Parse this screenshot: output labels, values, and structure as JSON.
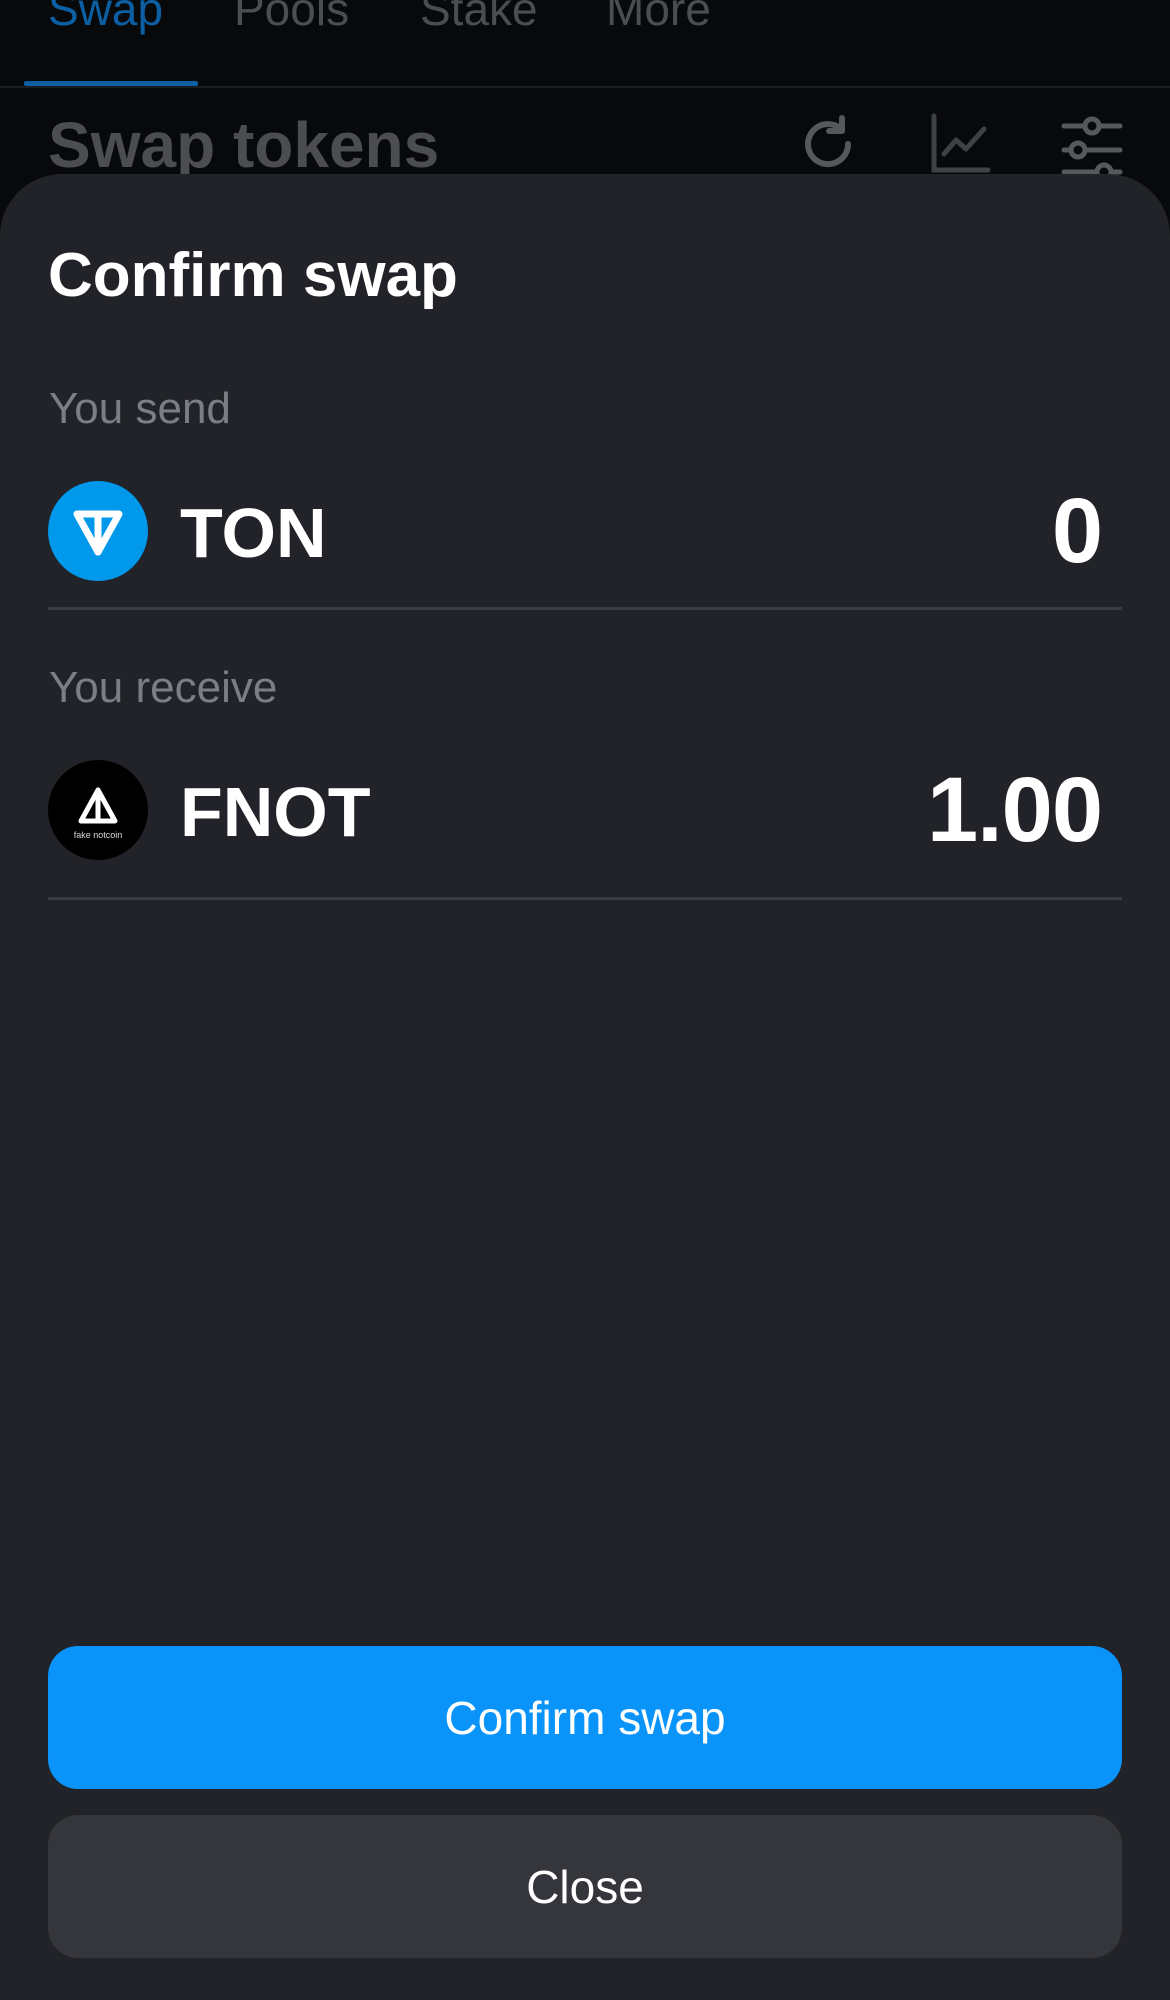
{
  "background": {
    "tabs": [
      {
        "label": "Swap",
        "active": true
      },
      {
        "label": "Pools",
        "active": false
      },
      {
        "label": "Stake",
        "active": false
      },
      {
        "label": "More",
        "active": false
      }
    ],
    "page_title": "Swap tokens",
    "icons": [
      "refresh-icon",
      "chart-icon",
      "settings-sliders-icon"
    ]
  },
  "sheet": {
    "title": "Confirm swap",
    "send": {
      "label": "You send",
      "token_symbol": "TON",
      "token_icon": "ton-icon",
      "amount": "0"
    },
    "receive": {
      "label": "You receive",
      "token_symbol": "FNOT",
      "token_icon": "fnot-icon",
      "token_icon_caption": "fake notcoin",
      "amount": "1.00"
    },
    "confirm_button": "Confirm swap",
    "close_button": "Close"
  },
  "colors": {
    "accent": "#0a94fa",
    "sheet_bg": "#222328",
    "ton_blue": "#0098ea",
    "secondary_button": "#35363b",
    "muted_text": "#7b7e84"
  }
}
